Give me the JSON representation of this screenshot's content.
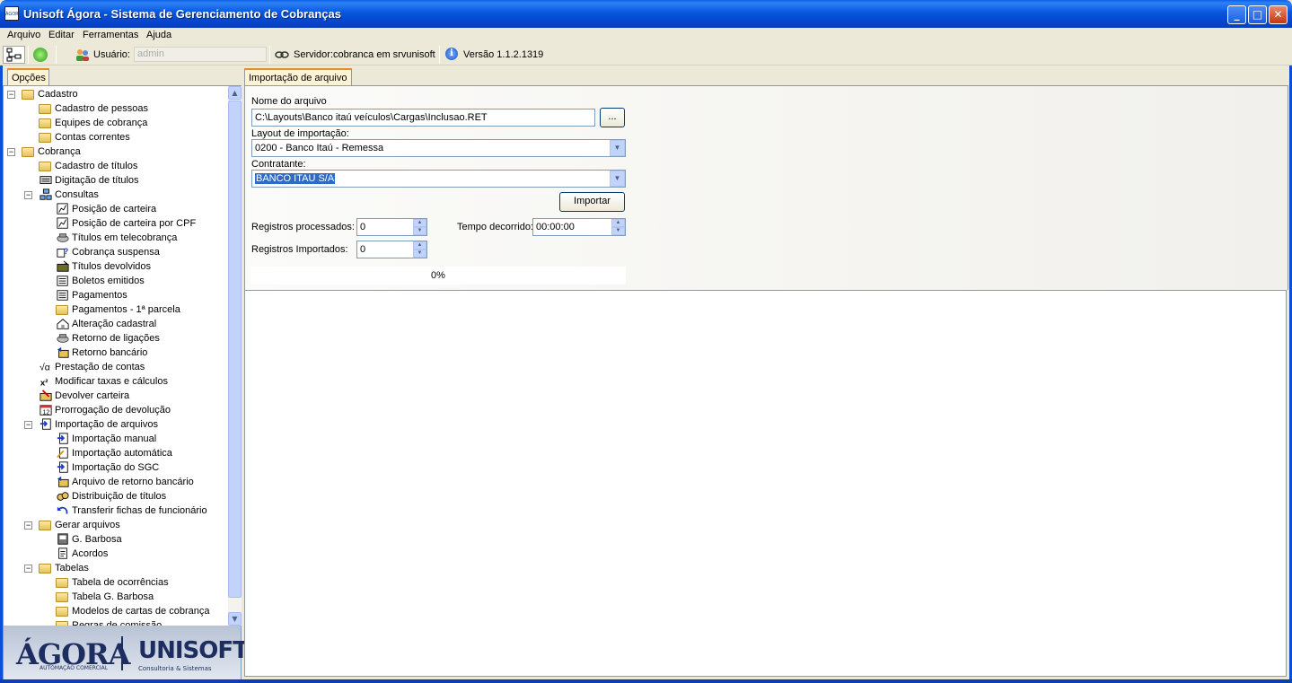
{
  "window": {
    "title": "Unisoft Ágora - Sistema de Gerenciamento de Cobranças",
    "app_icon_text": "ÁGORA"
  },
  "menu": [
    "Arquivo",
    "Editar",
    "Ferramentas",
    "Ajuda"
  ],
  "toolbar": {
    "user_label": "Usuário:",
    "user_value": "admin",
    "server_text": "Servidor:cobranca em srvunisoft",
    "version_text": "Versão 1.1.2.1319"
  },
  "left_tab": "Opções",
  "tree": [
    {
      "label": "Cadastro",
      "level": 0,
      "icon": "folder-open-icon",
      "expander": "−"
    },
    {
      "label": "Cadastro de pessoas",
      "level": 1,
      "icon": "folder-icon"
    },
    {
      "label": "Equipes de cobrança",
      "level": 1,
      "icon": "folder-icon"
    },
    {
      "label": "Contas correntes",
      "level": 1,
      "icon": "folder-icon"
    },
    {
      "label": "Cobrança",
      "level": 0,
      "icon": "folder-open-icon",
      "expander": "−"
    },
    {
      "label": "Cadastro de títulos",
      "level": 1,
      "icon": "folder-icon"
    },
    {
      "label": "Digitação de títulos",
      "level": 1,
      "icon": "keyboard-icon"
    },
    {
      "label": "Consultas",
      "level": 1,
      "icon": "network-icon",
      "expander": "−"
    },
    {
      "label": "Posição de carteira",
      "level": 2,
      "icon": "chart-icon"
    },
    {
      "label": "Posição de carteira por CPF",
      "level": 2,
      "icon": "chart-icon"
    },
    {
      "label": "Títulos em telecobrança",
      "level": 2,
      "icon": "phone-icon"
    },
    {
      "label": "Cobrança suspensa",
      "level": 2,
      "icon": "question-icon"
    },
    {
      "label": "Títulos devolvidos",
      "level": 2,
      "icon": "return-folder-icon"
    },
    {
      "label": "Boletos emitidos",
      "level": 2,
      "icon": "list-icon"
    },
    {
      "label": "Pagamentos",
      "level": 2,
      "icon": "list-icon"
    },
    {
      "label": "Pagamentos - 1ª parcela",
      "level": 2,
      "icon": "folder-icon"
    },
    {
      "label": "Alteração cadastral",
      "level": 2,
      "icon": "house-icon"
    },
    {
      "label": "Retorno de ligações",
      "level": 2,
      "icon": "phone-icon"
    },
    {
      "label": "Retorno bancário",
      "level": 2,
      "icon": "bank-return-icon"
    },
    {
      "label": "Prestação de contas",
      "level": 1,
      "icon": "sqrt-icon"
    },
    {
      "label": "Modificar taxas e cálculos",
      "level": 1,
      "icon": "formula-icon"
    },
    {
      "label": "Devolver carteira",
      "level": 1,
      "icon": "return-icon"
    },
    {
      "label": "Prorrogação de devolução",
      "level": 1,
      "icon": "calendar-icon"
    },
    {
      "label": "Importação de arquivos",
      "level": 1,
      "icon": "import-icon",
      "expander": "−"
    },
    {
      "label": "Importação manual",
      "level": 2,
      "icon": "import-icon"
    },
    {
      "label": "Importação automática",
      "level": 2,
      "icon": "import-auto-icon"
    },
    {
      "label": "Importação do SGC",
      "level": 2,
      "icon": "import-icon"
    },
    {
      "label": "Arquivo de retorno bancário",
      "level": 2,
      "icon": "bank-return-icon"
    },
    {
      "label": "Distribuição de títulos",
      "level": 2,
      "icon": "distribute-icon"
    },
    {
      "label": "Transferir fichas de funcionário",
      "level": 2,
      "icon": "undo-arrow-icon"
    },
    {
      "label": "Gerar arquivos",
      "level": 1,
      "icon": "folder-open-icon",
      "expander": "−"
    },
    {
      "label": "G. Barbosa",
      "level": 2,
      "icon": "export-icon"
    },
    {
      "label": "Acordos",
      "level": 2,
      "icon": "document-icon"
    },
    {
      "label": "Tabelas",
      "level": 1,
      "icon": "folder-open-icon",
      "expander": "−"
    },
    {
      "label": "Tabela de ocorrências",
      "level": 2,
      "icon": "folder-icon"
    },
    {
      "label": "Tabela G. Barbosa",
      "level": 2,
      "icon": "folder-icon"
    },
    {
      "label": "Modelos de cartas de cobrança",
      "level": 2,
      "icon": "folder-icon"
    },
    {
      "label": "Regras de comissão",
      "level": 2,
      "icon": "folder-icon"
    }
  ],
  "logos": {
    "agora": "ÁGORA",
    "agora_sub": "AUTOMAÇÃO COMERCIAL",
    "unisoft": "UNISOFT",
    "unisoft_sub": "Consultoria & Sistemas"
  },
  "right_tab": "Importação de arquivo",
  "form": {
    "file_label": "Nome do arquivo",
    "file_value": "C:\\Layouts\\Banco itaú veículos\\Cargas\\Inclusao.RET",
    "browse_label": "...",
    "layout_label": "Layout de importação:",
    "layout_value": "0200 - Banco Itaú - Remessa",
    "contractor_label": "Contratante:",
    "contractor_value": "BANCO ITAU S/A",
    "import_button": "Importar",
    "processed_label": "Registros processados:",
    "processed_value": "0",
    "elapsed_label": "Tempo decorrido:",
    "elapsed_value": "00:00:00",
    "imported_label": "Registros Importados:",
    "imported_value": "0",
    "progress_text": "0%",
    "progress_value": 0
  },
  "colors": {
    "titlebar": "#0054e3",
    "tab_accent": "#e68b2c",
    "selection": "#316ac5"
  }
}
